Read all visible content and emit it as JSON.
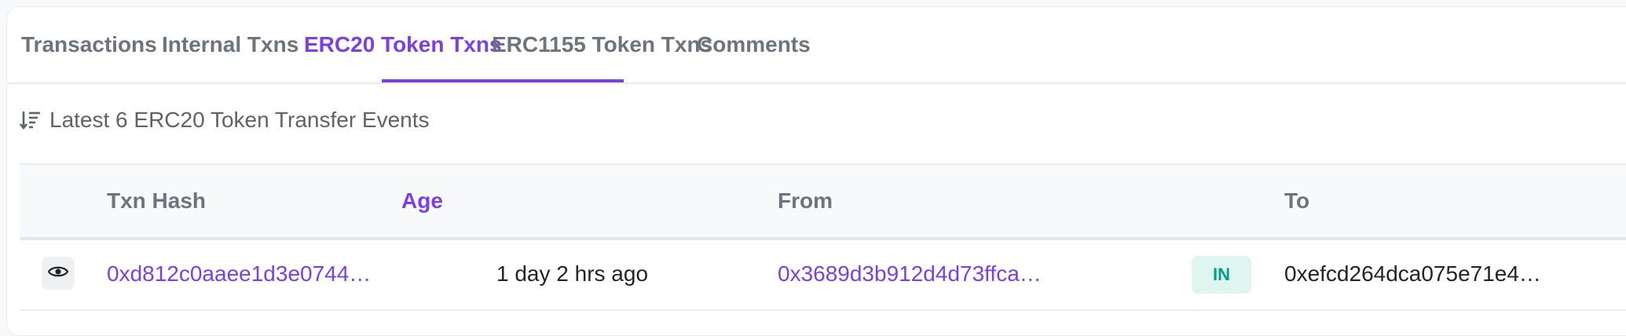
{
  "tabs": [
    {
      "label": "Transactions",
      "active": false
    },
    {
      "label": "Internal Txns",
      "active": false
    },
    {
      "label": "ERC20 Token Txns",
      "active": true
    },
    {
      "label": "ERC1155 Token Txns",
      "active": false
    },
    {
      "label": "Comments",
      "active": false
    }
  ],
  "summary": {
    "icon": "sort-descending-icon",
    "text": "Latest 6 ERC20 Token Transfer Events"
  },
  "table": {
    "columns": [
      "Txn Hash",
      "Age",
      "From",
      "To"
    ],
    "sorted_column": "Age",
    "rows": [
      {
        "view_icon": "eye-icon",
        "txn_hash": "0xd812c0aaee1d3e0744…",
        "age": "1 day 2 hrs ago",
        "from": "0x3689d3b912d4d73ffca…",
        "direction": "IN",
        "to": "0xefcd264dca075e71e4…"
      }
    ]
  },
  "colors": {
    "accent": "#7b3fe4",
    "muted_text": "#6c757d",
    "badge_in_bg": "#dff5ef",
    "badge_in_text": "#00a186"
  }
}
